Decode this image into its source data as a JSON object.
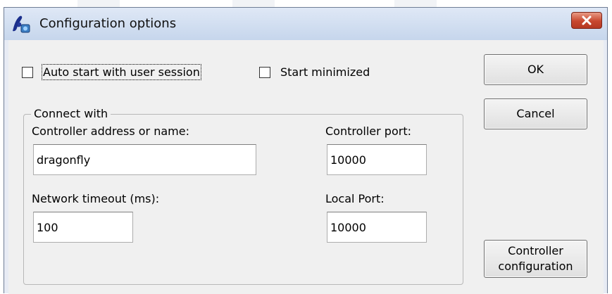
{
  "window": {
    "title": "Configuration options"
  },
  "options": {
    "auto_start_label": "Auto start with user session",
    "auto_start_checked": false,
    "start_minimized_label": "Start minimized",
    "start_minimized_checked": false
  },
  "buttons": {
    "ok": "OK",
    "cancel": "Cancel",
    "controller_configuration": [
      "Controller",
      "configuration"
    ]
  },
  "connect": {
    "legend": "Connect with",
    "controller_address_label": "Controller address or name:",
    "controller_address_value": "dragonfly",
    "controller_port_label": "Controller port:",
    "controller_port_value": "10000",
    "network_timeout_label": "Network timeout (ms):",
    "network_timeout_value": "100",
    "local_port_label": "Local Port:",
    "local_port_value": "10000"
  },
  "colors": {
    "titlebar": "#c6d6ec",
    "close_button": "#c8472f",
    "dialog_face": "#f0f0f0"
  }
}
